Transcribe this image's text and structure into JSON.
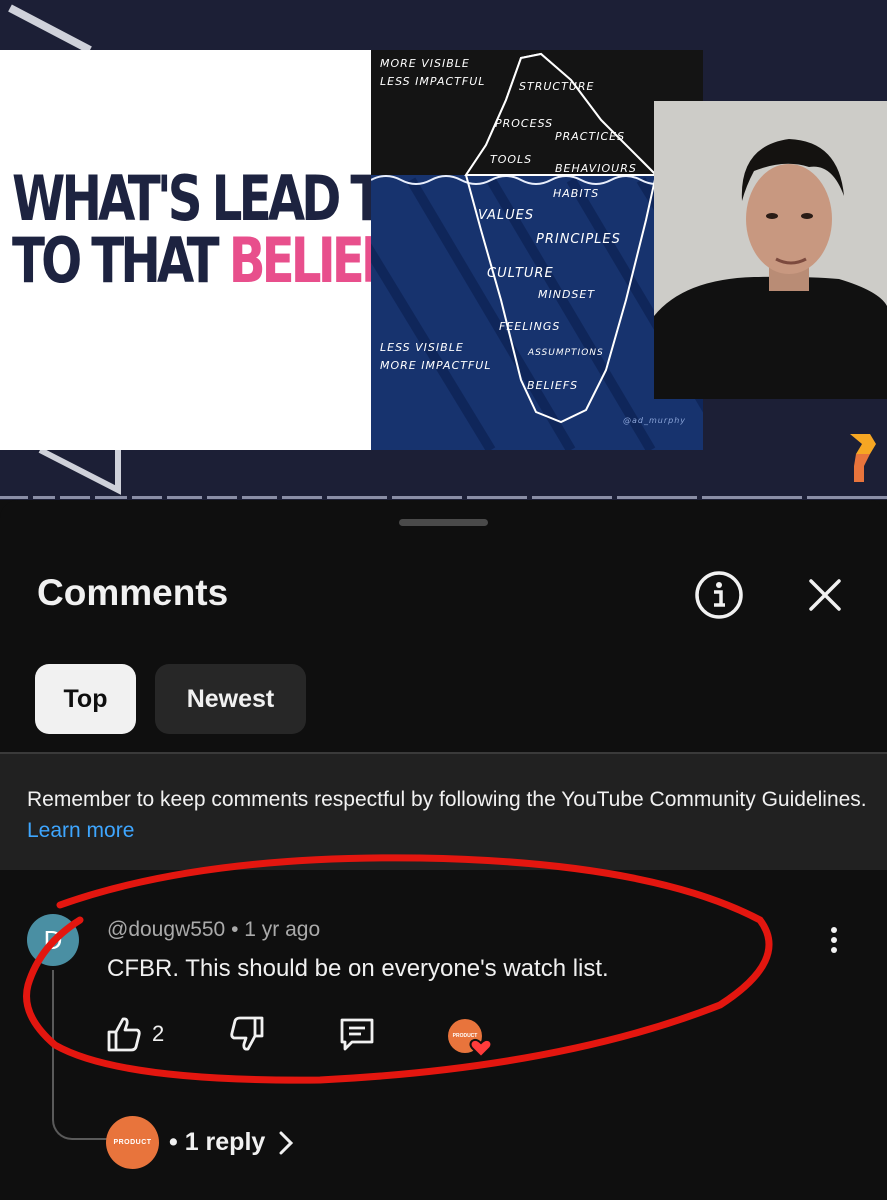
{
  "video": {
    "slide": {
      "title_line1": "WHAT'S LEAD THEM",
      "title_line2_prefix": "TO THAT ",
      "title_line2_highlight": "BELIEF?"
    },
    "iceberg": {
      "top_note_1": "More visible",
      "top_note_2": "Less impactful",
      "bottom_note_1": "Less visible",
      "bottom_note_2": "More impactful",
      "words": [
        "Structure",
        "Process",
        "Practices",
        "Tools",
        "Behaviours",
        "Habits",
        "Values",
        "Principles",
        "Culture",
        "Mindset",
        "Feelings",
        "Assumptions",
        "Beliefs"
      ],
      "credit": "@ad_murphy"
    },
    "colors": {
      "slide_pink": "#e84f8c",
      "slide_navy": "#1d2340",
      "brand_orange": "#e8743c"
    }
  },
  "comments": {
    "title": "Comments",
    "info_icon": "info-icon",
    "close_icon": "close-icon",
    "sort_chips": [
      {
        "label": "Top",
        "selected": true
      },
      {
        "label": "Newest",
        "selected": false
      }
    ],
    "notice": {
      "text": "Remember to keep comments respectful by following the YouTube Community Guidelines.",
      "link": "Learn more"
    },
    "items": [
      {
        "avatar_letter": "D",
        "author": "@dougw550",
        "time": "1 yr ago",
        "text": "CFBR. This should be on everyone's watch list.",
        "likes": "2",
        "reply_avatar_text": "PRODUCT",
        "replies_label": "1 reply"
      }
    ]
  }
}
